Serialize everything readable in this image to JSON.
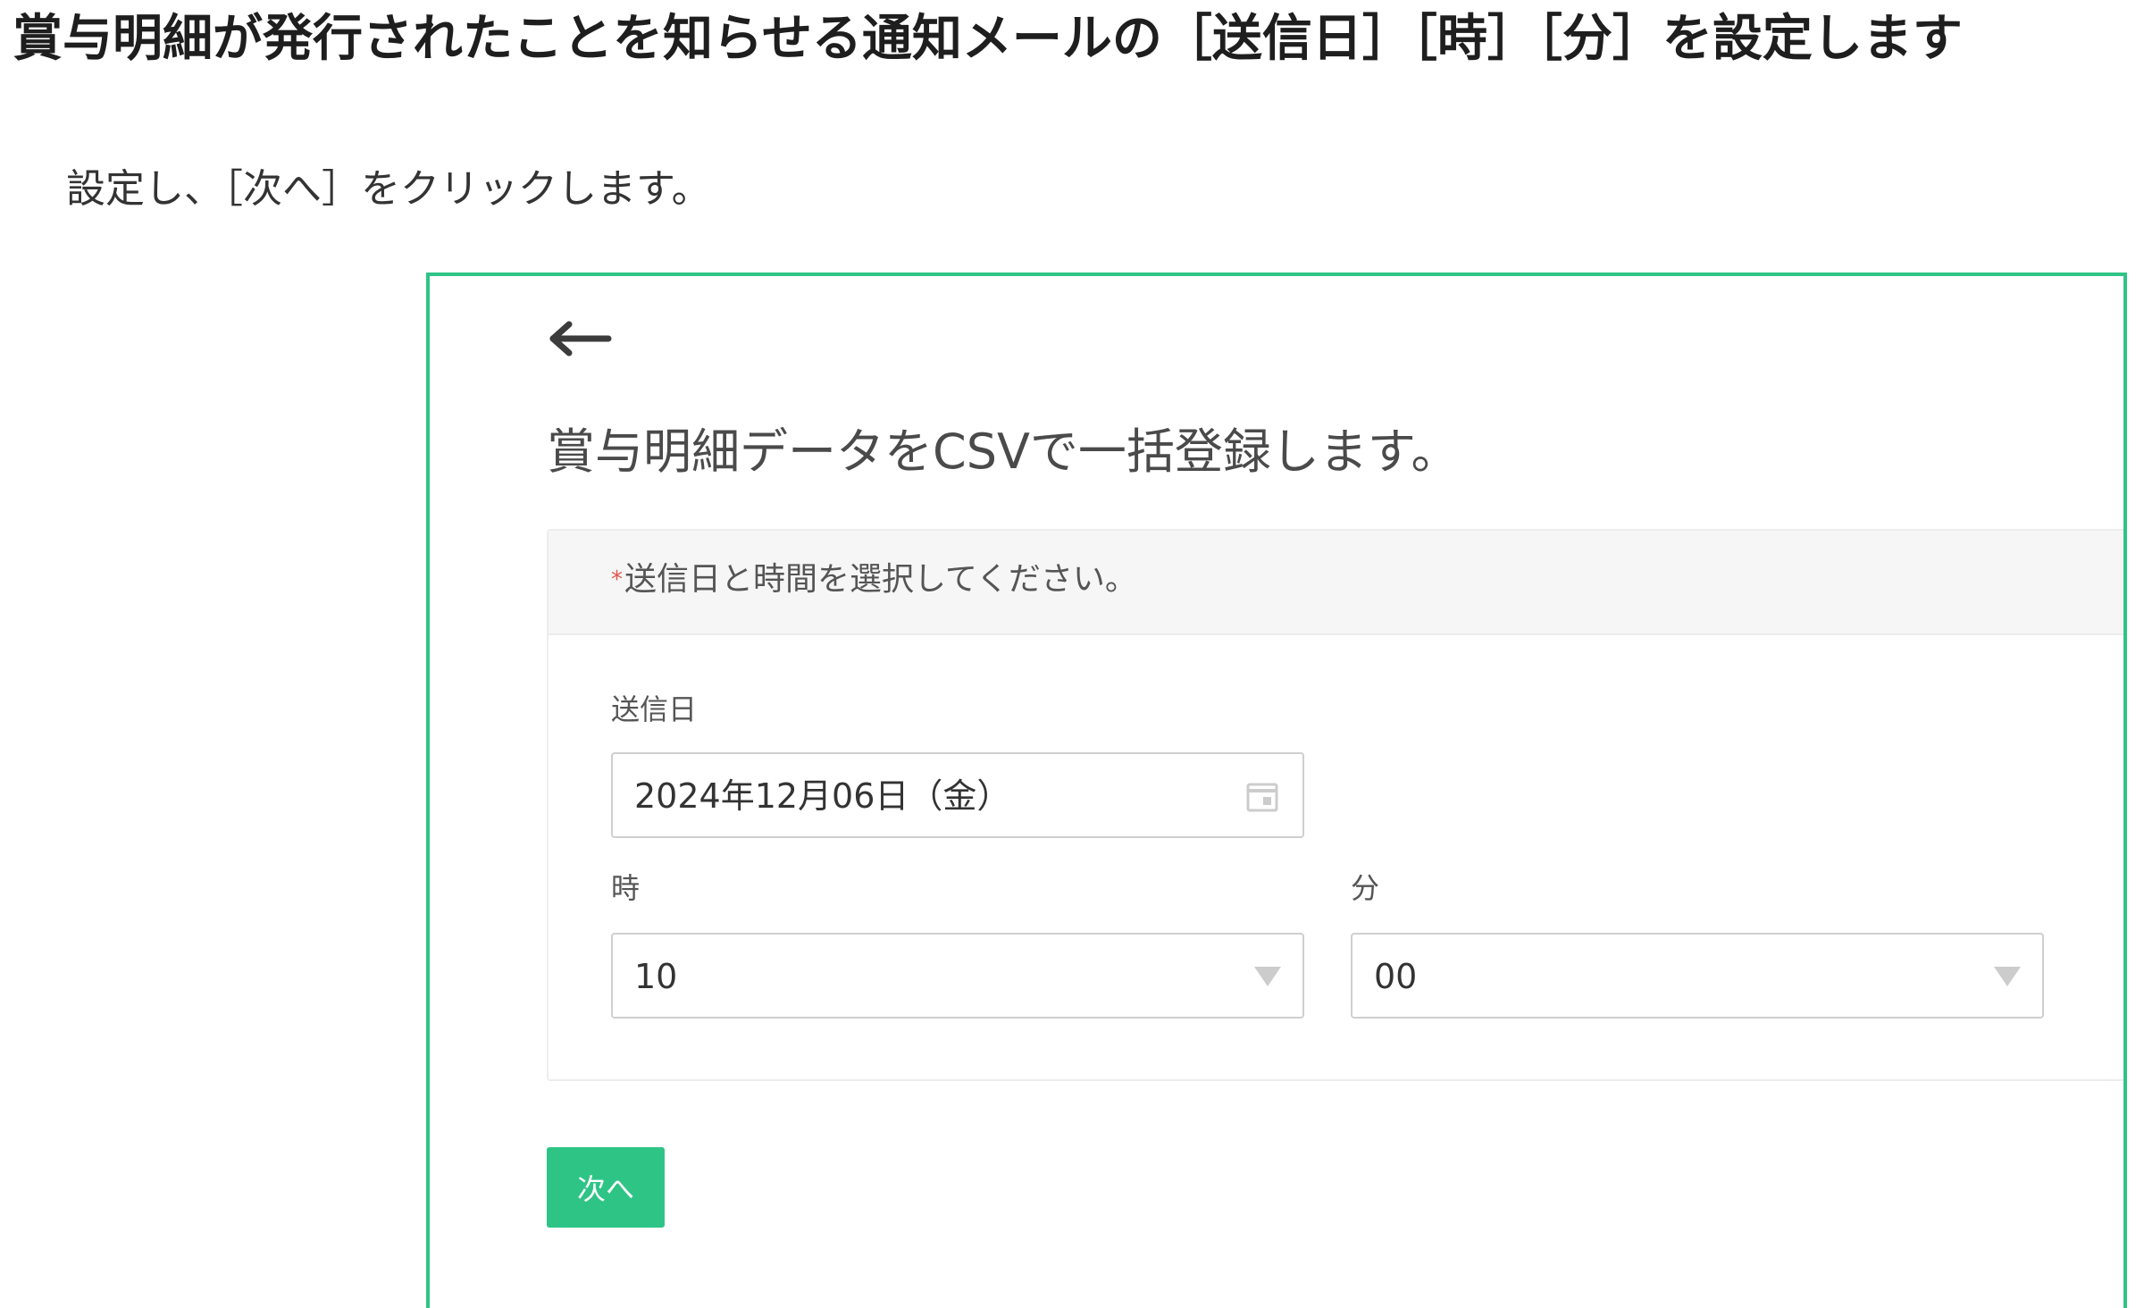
{
  "article": {
    "heading": "賞与明細が発行されたことを知らせる通知メールの［送信日］［時］［分］を設定します",
    "instruction": "設定し、［次へ］をクリックします。"
  },
  "screen": {
    "back_icon": "back-arrow-icon",
    "title": "賞与明細データをCSVで一括登録します。",
    "form": {
      "required_mark": "*",
      "instruction": "送信日と時間を選択してください。",
      "send_date": {
        "label": "送信日",
        "value": "2024年12月06日（金）",
        "icon": "calendar-icon"
      },
      "hour": {
        "label": "時",
        "value": "10",
        "icon": "chevron-down-icon"
      },
      "minute": {
        "label": "分",
        "value": "00",
        "icon": "chevron-down-icon"
      }
    },
    "next_button_label": "次へ"
  },
  "colors": {
    "accent": "#2ec486",
    "required": "#e2574c",
    "card_header_bg": "#f6f6f6",
    "field_border": "#cfcfcf"
  }
}
